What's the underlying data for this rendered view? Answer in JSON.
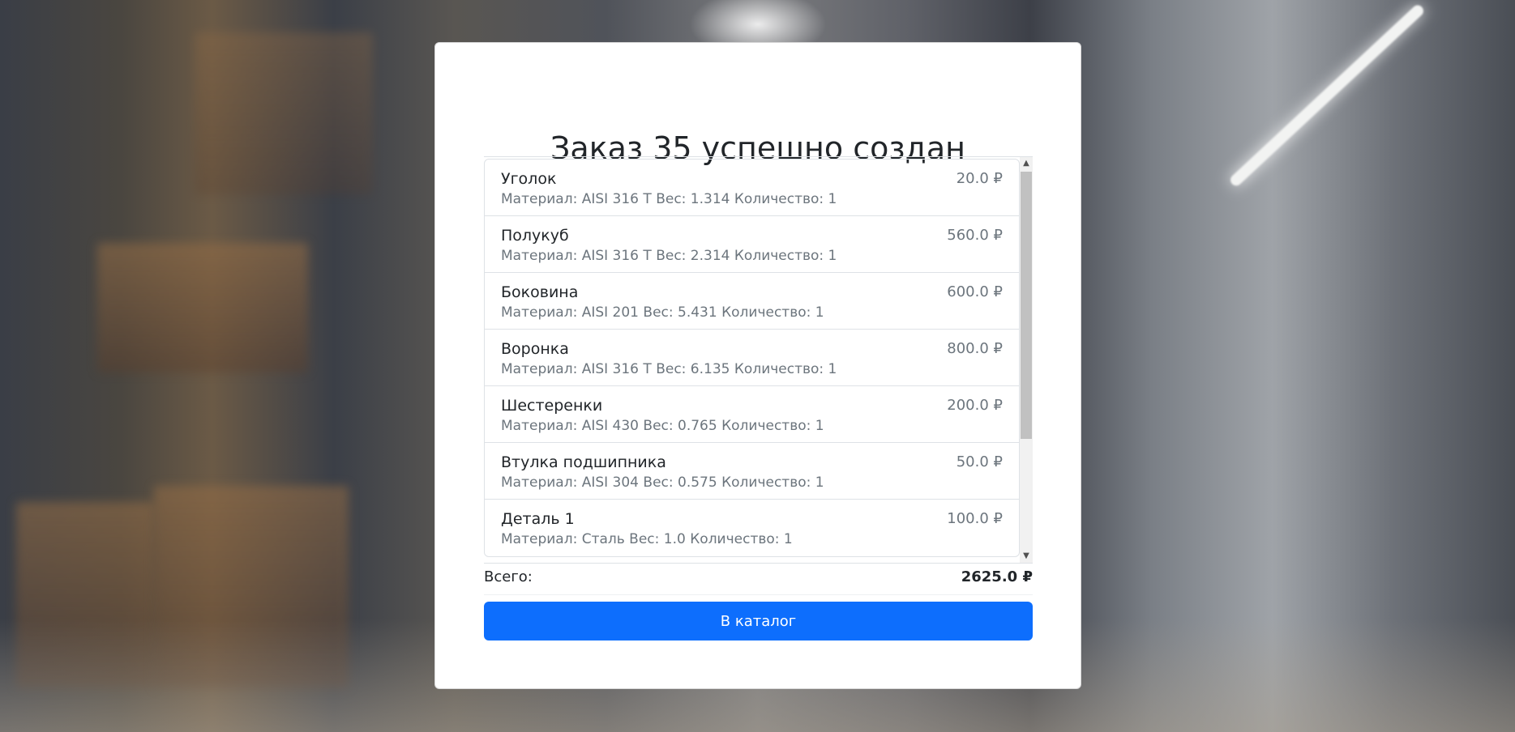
{
  "page": {
    "title": "Заказ 35 успешно создан"
  },
  "order": {
    "items": [
      {
        "name": "Уголок",
        "desc": "Материал: AISI 316 T Вес: 1.314 Количество: 1",
        "price": "20.0 ₽"
      },
      {
        "name": "Полукуб",
        "desc": "Материал: AISI 316 T Вес: 2.314 Количество: 1",
        "price": "560.0 ₽"
      },
      {
        "name": "Боковина",
        "desc": "Материал: AISI 201 Вес: 5.431 Количество: 1",
        "price": "600.0 ₽"
      },
      {
        "name": "Воронка",
        "desc": "Материал: AISI 316 T Вес: 6.135 Количество: 1",
        "price": "800.0 ₽"
      },
      {
        "name": "Шестеренки",
        "desc": "Материал: AISI 430 Вес: 0.765 Количество: 1",
        "price": "200.0 ₽"
      },
      {
        "name": "Втулка подшипника",
        "desc": "Материал: AISI 304 Вес: 0.575 Количество: 1",
        "price": "50.0 ₽"
      },
      {
        "name": "Деталь 1",
        "desc": "Материал: Сталь Вес: 1.0 Количество: 1",
        "price": "100.0 ₽"
      }
    ],
    "total_label": "Всего:",
    "total_value": "2625.0 ₽"
  },
  "actions": {
    "catalog_button": "В каталог"
  },
  "colors": {
    "primary": "#0d6efd",
    "muted": "#6c757d",
    "text": "#212529"
  }
}
